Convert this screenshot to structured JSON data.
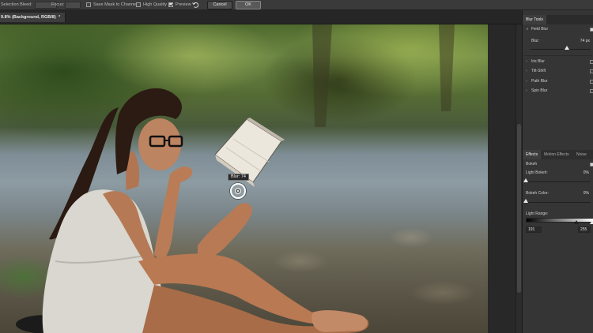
{
  "options_bar": {
    "selection_bleed_label": "Selection Bleed:",
    "focus_label": "Focus:",
    "save_mask_label": "Save Mask to Channels",
    "high_quality_label": "High Quality",
    "preview_label": "Preview",
    "preview_checked": true,
    "cancel_label": "Cancel",
    "ok_label": "OK"
  },
  "document_tab": {
    "title": "9.8% (Background, RGB/8)",
    "menu_glyph": "*"
  },
  "canvas": {
    "pin_tooltip": "Blur: 74"
  },
  "blur_tools_panel": {
    "tab_label": "Blur Tools",
    "field_blur": {
      "label": "Field Blur",
      "checked": true,
      "expanded": true
    },
    "blur_label": "Blur:",
    "blur_value": "74 px",
    "blur_level": 74,
    "blur_max": 500,
    "other_blurs": [
      {
        "label": "Iris Blur",
        "checked": false
      },
      {
        "label": "Tilt-Shift",
        "checked": false
      },
      {
        "label": "Path Blur",
        "checked": false
      },
      {
        "label": "Spin Blur",
        "checked": false
      }
    ]
  },
  "effects_panel": {
    "tabs": [
      "Effects",
      "Motion Effects",
      "Noise"
    ],
    "active_tab": "Effects",
    "bokeh_label": "Bokeh",
    "bokeh_checked": true,
    "light_bokeh_label": "Light Bokeh:",
    "light_bokeh_value": "0%",
    "light_bokeh_level": 0,
    "bokeh_color_label": "Bokeh Color:",
    "bokeh_color_value": "0%",
    "bokeh_color_level": 0,
    "light_range_label": "Light Range:",
    "light_range_low": "191",
    "light_range_high": "255"
  },
  "colors": {
    "ui_dark": "#282828",
    "panel": "#353535",
    "options_bar": "#3a3a3a",
    "pin": "#ffffff"
  },
  "icons": {
    "reset_pins": "reset-pins-icon",
    "expand": "chevron-right-icon",
    "collapse": "chevron-down-icon"
  }
}
